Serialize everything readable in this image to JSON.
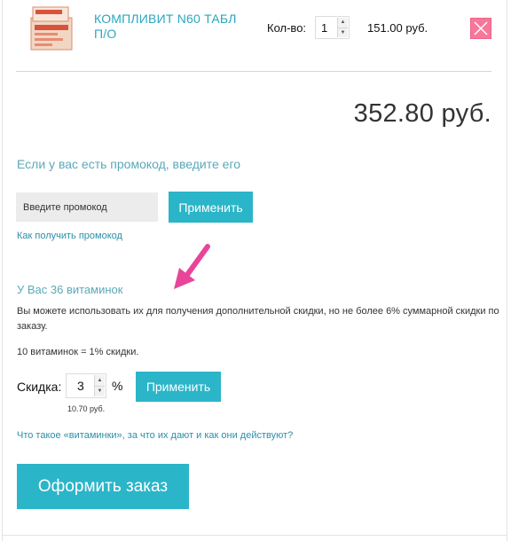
{
  "cart_item": {
    "name": "КОМПЛИВИТ N60 ТАБЛ П/О",
    "qty_label": "Кол-во:",
    "qty": "1",
    "price": "151.00 руб.",
    "remove_icon": "close-icon"
  },
  "total": "352.80 руб.",
  "promo": {
    "heading": "Если у вас есть промокод, введите его",
    "placeholder": "Введите промокод",
    "apply_label": "Применить",
    "help_link": "Как получить промокод"
  },
  "vitamins": {
    "heading": "У Вас 36 витаминок",
    "description": "Вы можете использовать их для получения дополнительной скидки, но не более 6% суммарной скидки по заказу.",
    "rate": "10 витаминок = 1% скидки.",
    "discount_label": "Скидка:",
    "discount_value": "3",
    "percent_sign": "%",
    "apply_label": "Применить",
    "discount_amount": "10.70 руб.",
    "help_link": "Что такое «витаминки», за что их дают и как они действуют?"
  },
  "checkout_label": "Оформить заказ",
  "colors": {
    "accent": "#2bb5c8",
    "link": "#2a8fa8",
    "remove": "#f5789a",
    "arrow": "#e8459a"
  }
}
